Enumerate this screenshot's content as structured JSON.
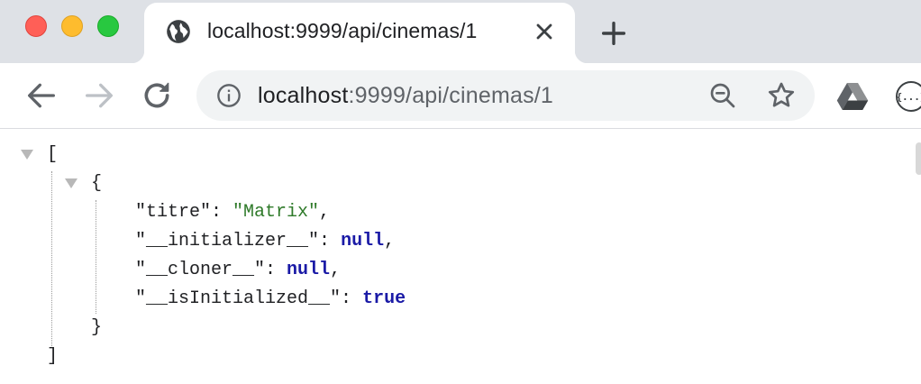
{
  "tab": {
    "title": "localhost:9999/api/cinemas/1",
    "favicon": "globe-icon",
    "close_icon": "close-icon"
  },
  "toolbar": {
    "url_host": "localhost",
    "url_rest": ":9999/api/cinemas/1",
    "icons": [
      "back-arrow-icon",
      "forward-arrow-icon",
      "reload-icon",
      "info-icon",
      "zoom-out-icon",
      "star-icon",
      "google-drive-icon",
      "json-viewer-icon"
    ],
    "json_ext_label": "{...}"
  },
  "json": {
    "open_bracket": "[",
    "close_bracket": "]",
    "open_brace": "{",
    "close_brace": "}",
    "props": [
      {
        "key": "\"titre\"",
        "value": "\"Matrix\"",
        "type": "string",
        "comma": ","
      },
      {
        "key": "\"__initializer__\"",
        "value": "null",
        "type": "null",
        "comma": ","
      },
      {
        "key": "\"__cloner__\"",
        "value": "null",
        "type": "null",
        "comma": ","
      },
      {
        "key": "\"__isInitialized__\"",
        "value": "true",
        "type": "bool",
        "comma": ""
      }
    ]
  },
  "colors": {
    "tabstrip": "#dee1e6",
    "omnibox": "#f1f3f4",
    "json_string": "#2f7a2a",
    "json_keyword": "#1a1aa6"
  }
}
